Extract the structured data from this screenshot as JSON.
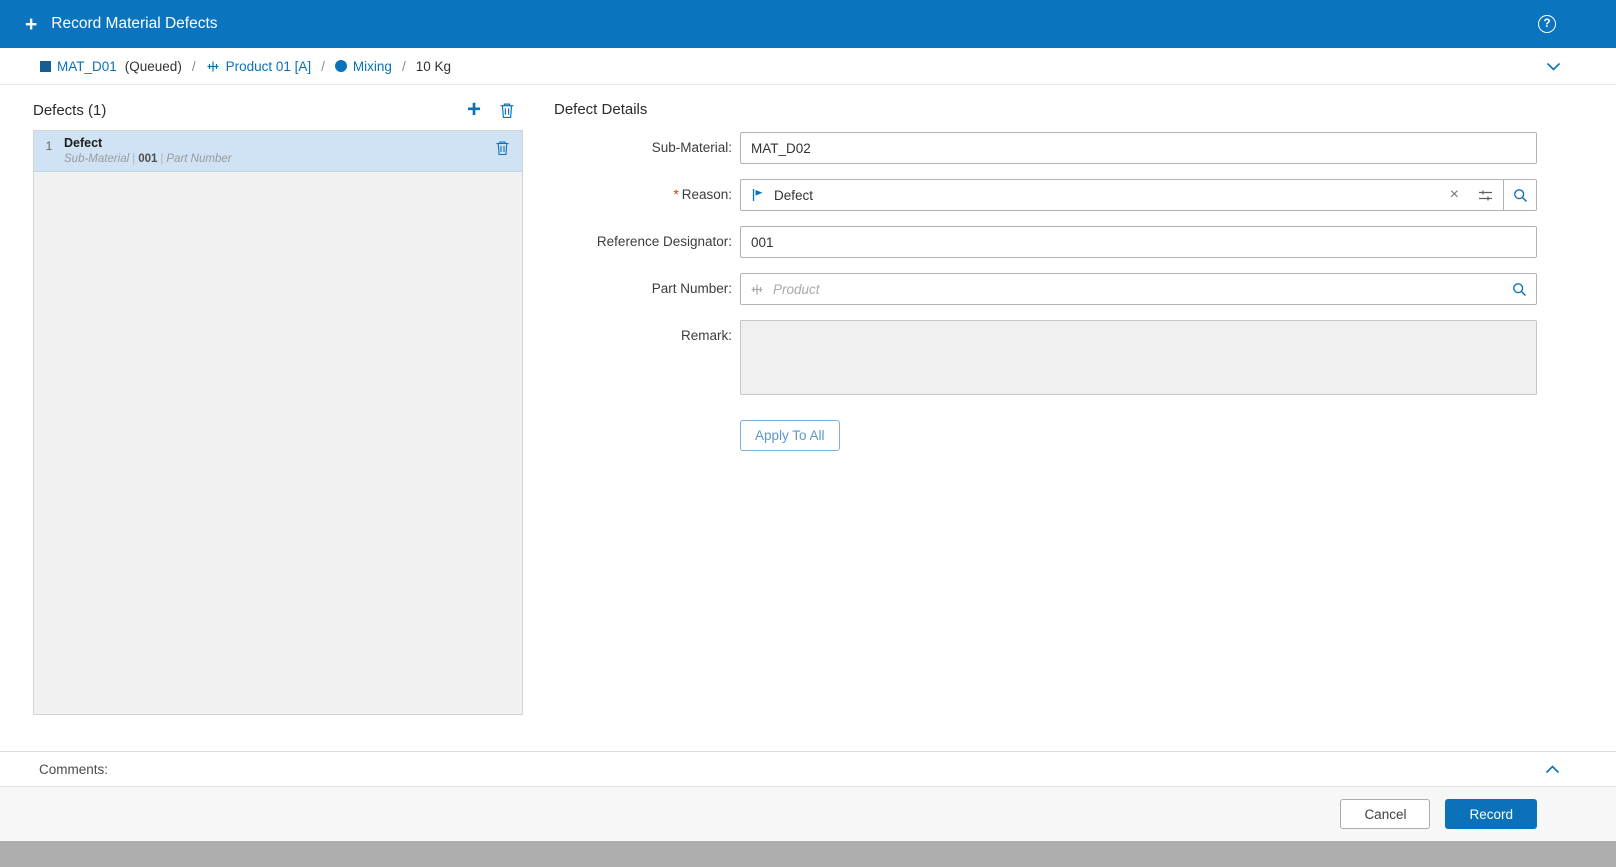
{
  "colors": {
    "header_bg": "#0a74bf",
    "accent_blue": "#0b72ba",
    "selected_row_bg": "#cfe3f4",
    "required_marker_color": "#d83b01",
    "list_bg": "#f1f1f1",
    "footer_bg": "#f7f7f7"
  },
  "header": {
    "add_icon": "+",
    "title": "Record Material Defects",
    "help_icon": "?"
  },
  "breadcrumb": {
    "separator": "/",
    "material_name": "MAT_D01",
    "material_state": "(Queued)",
    "product_name": "Product 01 [A]",
    "step_name": "Mixing",
    "quantity": "10 Kg"
  },
  "defects_panel": {
    "title": "Defects (1)",
    "add_icon": "+",
    "items": [
      {
        "index": "1",
        "title": "Defect",
        "sub_material_label": "Sub-Material",
        "separator": "|",
        "reference": "001",
        "part_number_label": "Part Number"
      }
    ]
  },
  "details": {
    "title": "Defect Details",
    "required_marker": "*",
    "sub_material": {
      "label": "Sub-Material:",
      "value": "MAT_D02"
    },
    "reason": {
      "label": "Reason:",
      "value": "Defect",
      "clear_icon": "×"
    },
    "reference_designator": {
      "label": "Reference Designator:",
      "value": "001"
    },
    "part_number": {
      "label": "Part Number:",
      "placeholder": "Product"
    },
    "remark": {
      "label": "Remark:",
      "value": ""
    },
    "apply_to_all_label": "Apply To All"
  },
  "comments": {
    "label": "Comments:"
  },
  "footer": {
    "cancel_label": "Cancel",
    "record_label": "Record"
  }
}
